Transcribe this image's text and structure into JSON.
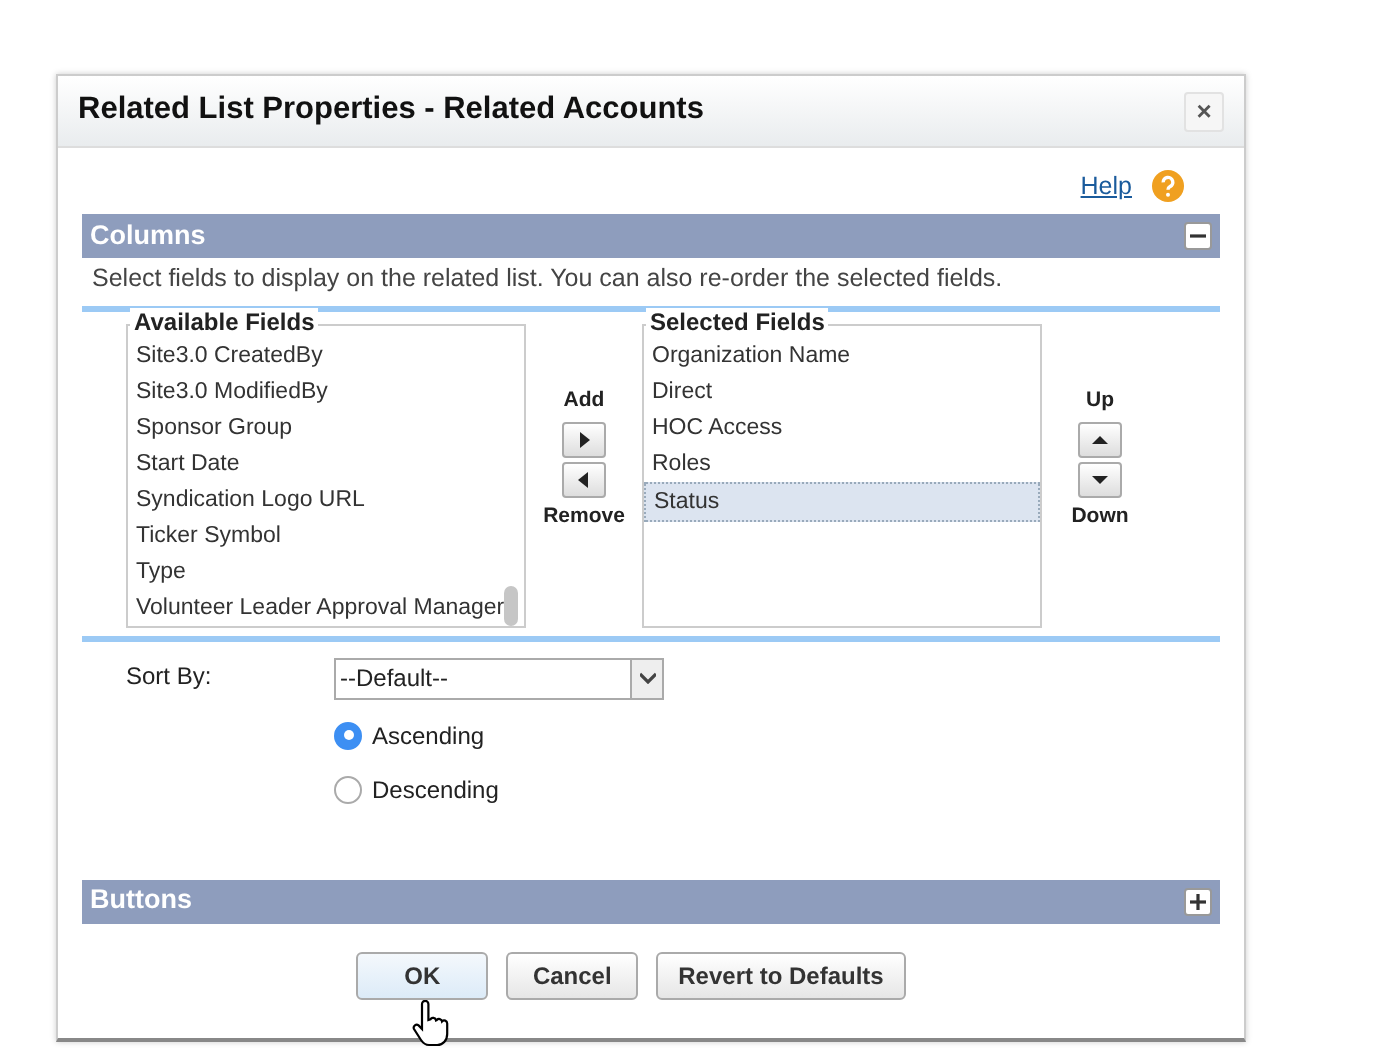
{
  "dialog": {
    "title": "Related List Properties - Related Accounts",
    "close": "×"
  },
  "help": {
    "label": "Help"
  },
  "sections": [
    {
      "title": "Columns",
      "expanded": true,
      "description": "Select fields to display on the related list. You can also re-order the selected fields."
    },
    {
      "title": "Buttons",
      "expanded": false
    }
  ],
  "available_fields": {
    "label": "Available Fields",
    "items": [
      {
        "label": "Site3.0 CreatedBy",
        "selected": false
      },
      {
        "label": "Site3.0 ModifiedBy",
        "selected": false
      },
      {
        "label": "Sponsor Group",
        "selected": false
      },
      {
        "label": "Start Date",
        "selected": false
      },
      {
        "label": "Syndication Logo URL",
        "selected": false
      },
      {
        "label": "Ticker Symbol",
        "selected": false
      },
      {
        "label": "Type",
        "selected": false
      },
      {
        "label": "Volunteer Leader Approval Manager",
        "selected": false
      }
    ]
  },
  "move_buttons": {
    "add": "Add",
    "remove": "Remove"
  },
  "selected_fields": {
    "label": "Selected Fields",
    "items": [
      {
        "label": "Organization Name",
        "selected": false
      },
      {
        "label": "Direct",
        "selected": false
      },
      {
        "label": "HOC Access",
        "selected": false
      },
      {
        "label": "Roles",
        "selected": false
      },
      {
        "label": "Status",
        "selected": true
      }
    ]
  },
  "order_buttons": {
    "up": "Up",
    "down": "Down"
  },
  "sort": {
    "label": "Sort By:",
    "value": "--Default--",
    "options": [
      {
        "label": "Ascending",
        "selected": true
      },
      {
        "label": "Descending",
        "selected": false
      }
    ]
  },
  "actions": [
    "OK",
    "Cancel",
    "Revert to Defaults"
  ]
}
